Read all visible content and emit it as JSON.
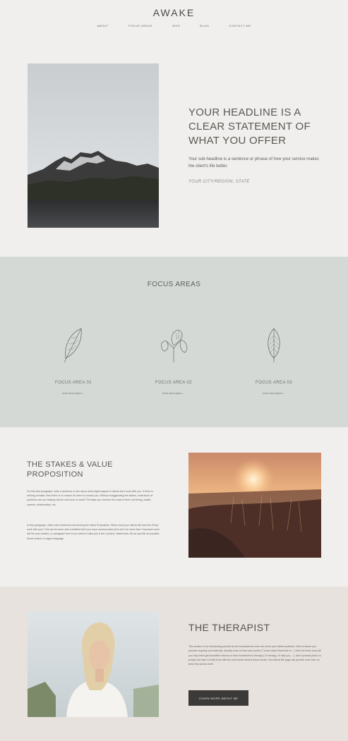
{
  "header": {
    "logo": "AWAKE",
    "nav": [
      "ABOUT",
      "FOCUS AREAS",
      "INFO",
      "BLOG",
      "CONTACT ME"
    ]
  },
  "hero": {
    "headline": "YOUR HEADLINE IS A CLEAR STATEMENT OF WHAT YOU OFFER",
    "subheadline": "Your sub-headline is a sentence or phrase of how your service makes the client's life better.",
    "location": "YOUR CITY/REGION, STATE"
  },
  "focus": {
    "title": "FOCUS AREAS",
    "items": [
      {
        "title": "FOCUS AREA 01",
        "desc": "brief description..."
      },
      {
        "title": "FOCUS AREA 02",
        "desc": "brief description..."
      },
      {
        "title": "FOCUS AREA 03",
        "desc": "brief description..."
      }
    ]
  },
  "stakes": {
    "title": "THE STAKES & VALUE PROPOSITION",
    "para1": "For this first paragraph, write a sentence or two about what might happen if clients don't work with you. If there is nothing at stake, then there is no reason for them to contact you. Without exaggerating the stakes, what kinds of problems are you helping clients overcome or avoid? Perhaps you mention the costs to their well-being, health, careers, relationships, etc.",
    "para2": "In this paragraph, write a few sentences introducing the Value Proposition. What could your clients life look like if they work with you? This can be done with a bulleted list if you have several points (but don't do more than 4 because more will tire your reader), or paragraph form if you want to make just a few \"punchy\" statements. Be as specific as possible. Avoid elusive or vague language."
  },
  "therapist": {
    "title": "THE THERAPIST",
    "body": "This section is for introducing yourself as the brand/person who can solve your clients problem. Here is where you provide empathy and authority. Identify a few of their pain points (\"I know what it feels like to...\") then tell them how will you help them get incredible returns on their investment in therapy (\"In therapy, I'll help you...\"). Add a portrait photo so people can start to build trust with the real human behind these words. Your About Me page will provide more info, so keep this section brief.",
    "button": "LEARN MORE ABOUT ME"
  }
}
